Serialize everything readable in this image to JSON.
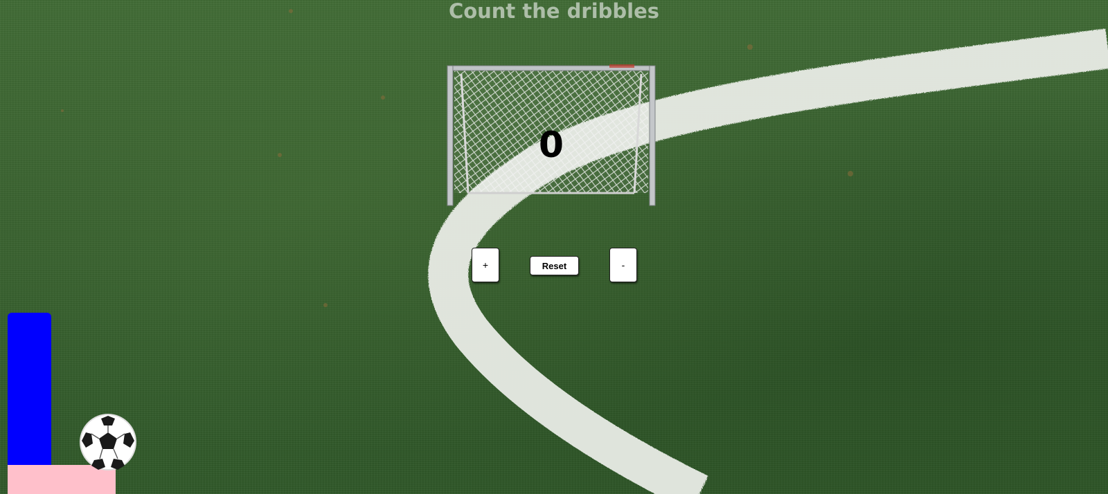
{
  "page": {
    "title": "Count the dribbles"
  },
  "counter": {
    "value": "0"
  },
  "controls": {
    "increment_label": "+",
    "reset_label": "Reset",
    "decrement_label": "-"
  },
  "colors": {
    "grass": "#355e2d",
    "field_line": "#e9ece6",
    "title_text": "#b9c7b5",
    "player_bar": "#0000ff",
    "player_base": "#ffc0cb",
    "button_bg": "#ffffff"
  },
  "icons": {
    "goal": "soccer-goal-icon",
    "ball": "soccer-ball-icon"
  }
}
